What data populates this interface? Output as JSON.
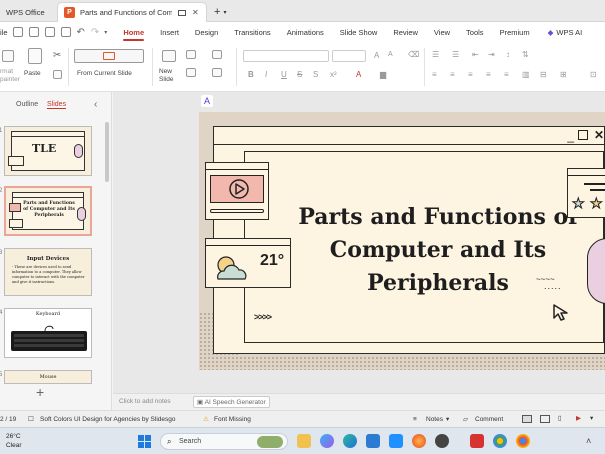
{
  "tabs": [
    {
      "label": "WPS Office",
      "active": false
    },
    {
      "label": "Parts and Functions of Comp",
      "active": true
    }
  ],
  "menu": {
    "file": "ile",
    "items": [
      "Home",
      "Insert",
      "Design",
      "Transitions",
      "Animations",
      "Slide Show",
      "Review",
      "View",
      "Tools",
      "Premium"
    ],
    "active": "Home",
    "wps_ai": "WPS AI"
  },
  "ribbon": {
    "format_painter": "rmat\npainter",
    "paste": "Paste",
    "from_current_slide": "From Current Slide",
    "new_slide": "New\nSlide",
    "bold": "B",
    "italic": "I",
    "underline": "U",
    "strike": "S",
    "shadow": "S",
    "font_size_a": "A",
    "font_size_b": "A"
  },
  "left_panel": {
    "tab_outline": "Outline",
    "tab_slides": "Slides",
    "collapse": "‹",
    "add": "+",
    "thumbnails": [
      {
        "num": "1",
        "text": "TLE"
      },
      {
        "num": "2",
        "text": "Parts and Functions of Computer and Its Peripherals"
      },
      {
        "num": "3",
        "title": "Input Devices",
        "text": "- These are devices used to send information to a computer. They allow computer to interact with the computer and give it instructions."
      },
      {
        "num": "4",
        "text": "Keyboard"
      },
      {
        "num": "5",
        "text": "Mouse"
      }
    ]
  },
  "slide": {
    "title": "Parts and Functions of Computer and Its Peripherals",
    "weather": "21°",
    "arrows": ">>>>",
    "squiggle": "~~~~",
    "dots": "....."
  },
  "notes": {
    "placeholder": "Click to add notes",
    "ai_speech": "AI Speech Generator"
  },
  "status": {
    "slide_counter": "2 / 19",
    "theme": "Soft Colors UI Design for Agencies by Slidesgo",
    "font_missing": "Font Missing",
    "notes": "Notes",
    "comment": "Comment"
  },
  "taskbar": {
    "temp": "26°C",
    "cond": "Clear",
    "search": "Search"
  },
  "colors": {
    "accent": "#c0392b",
    "slide_bg": "#e0d4c6",
    "cream": "#fdf4e2",
    "pink": "#e8a598"
  }
}
